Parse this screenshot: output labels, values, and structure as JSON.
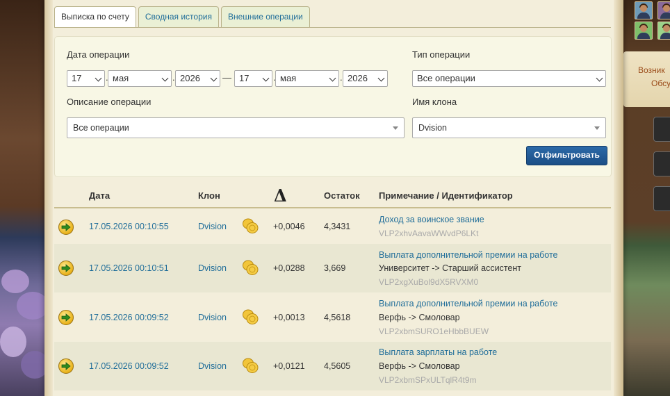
{
  "tabs": [
    {
      "label": "Выписка по счету",
      "active": true
    },
    {
      "label": "Сводная история",
      "active": false
    },
    {
      "label": "Внешние операции",
      "active": false
    }
  ],
  "filter": {
    "date_label": "Дата операции",
    "from": {
      "day": "17",
      "month": "мая",
      "year": "2026"
    },
    "to": {
      "day": "17",
      "month": "мая",
      "year": "2026"
    },
    "dash": "—",
    "type_label": "Тип операции",
    "type_value": "Все операции",
    "desc_label": "Описание операции",
    "desc_value": "Все операции",
    "clone_label": "Имя клона",
    "clone_value": "Dvision",
    "button": "Отфильтровать"
  },
  "table": {
    "headers": {
      "date": "Дата",
      "clone": "Клон",
      "delta": "Δ",
      "balance": "Остаток",
      "note": "Примечание / Идентификатор"
    },
    "rows": [
      {
        "date": "17.05.2026 00:10:55",
        "clone": "Dvision",
        "delta": "+0,0046",
        "balance": "4,3431",
        "note": "Доход за воинское звание",
        "detail": "",
        "id": "VLP2xhvAavaWWvdP6LKt"
      },
      {
        "date": "17.05.2026 00:10:51",
        "clone": "Dvision",
        "delta": "+0,0288",
        "balance": "3,669",
        "note": "Выплата дополнительной премии на работе",
        "detail": "Университет -> Старший ассистент",
        "id": "VLP2xgXuBol9dX5RVXM0"
      },
      {
        "date": "17.05.2026 00:09:52",
        "clone": "Dvision",
        "delta": "+0,0013",
        "balance": "4,5618",
        "note": "Выплата дополнительной премии на работе",
        "detail": "Верфь -> Смоловар",
        "id": "VLP2xbmSURO1eHbbBUEW"
      },
      {
        "date": "17.05.2026 00:09:52",
        "clone": "Dvision",
        "delta": "+0,0121",
        "balance": "4,5605",
        "note": "Выплата зарплаты на работе",
        "detail": "Верфь -> Смоловар",
        "id": "VLP2xbmSPxULTqlR4t9m"
      }
    ]
  },
  "sidebar": {
    "line1": "Возник",
    "line2": "Обсу"
  },
  "colors": {
    "link": "#1f6d99",
    "button": "#1b4e86",
    "parchment": "#f3eedb"
  }
}
